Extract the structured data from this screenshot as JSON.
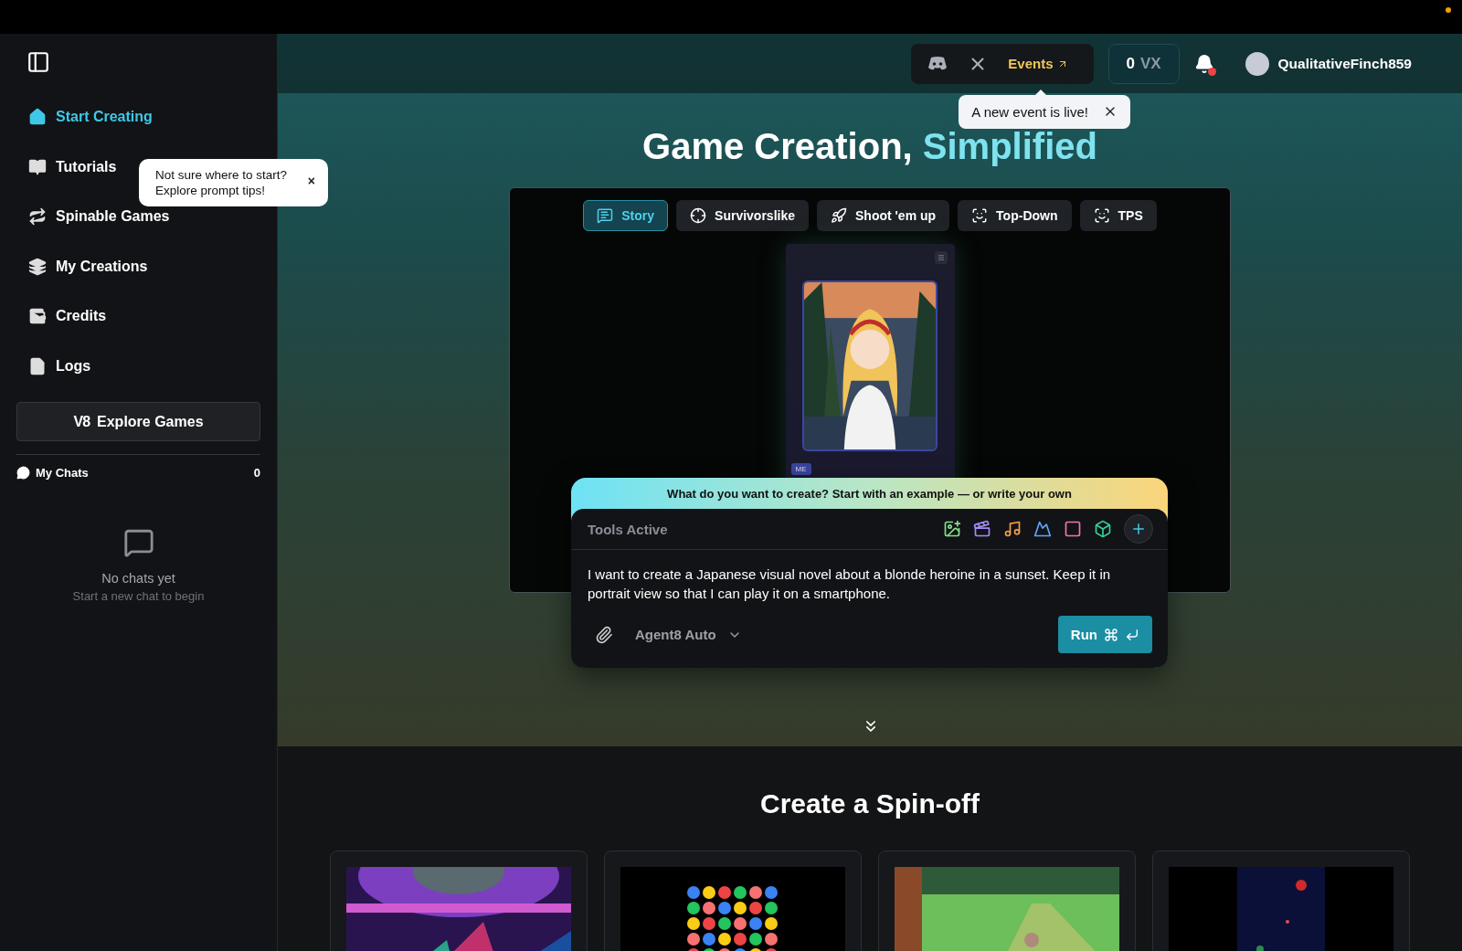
{
  "sidebar": {
    "items": [
      {
        "label": "Start Creating",
        "selected": true
      },
      {
        "label": "Tutorials",
        "selected": false
      },
      {
        "label": "Spinable Games",
        "selected": false
      },
      {
        "label": "My Creations",
        "selected": false
      },
      {
        "label": "Credits",
        "selected": false
      },
      {
        "label": "Logs",
        "selected": false
      }
    ],
    "tip": {
      "text": "Not sure where to start? Explore prompt tips!",
      "close": "×"
    },
    "explore": {
      "logo": "V8",
      "label": "Explore Games"
    },
    "chats": {
      "title": "My Chats",
      "count": "0",
      "empty_title": "No chats yet",
      "empty_hint": "Start a new chat to begin"
    }
  },
  "header": {
    "events": "Events",
    "balance": {
      "amount": "0",
      "unit": "VX"
    },
    "notification": true,
    "username": "QualitativeFinch859",
    "event_toast": "A new event is live!"
  },
  "hero": {
    "title_plain": "Game Creation,",
    "title_accent": "Simplified",
    "tabs": [
      {
        "label": "Story",
        "selected": true
      },
      {
        "label": "Survivorslike",
        "selected": false
      },
      {
        "label": "Shoot 'em up",
        "selected": false
      },
      {
        "label": "Top-Down",
        "selected": false
      },
      {
        "label": "TPS",
        "selected": false
      }
    ],
    "preview": {
      "badge": "ME"
    },
    "prompt": {
      "banner": "What do you want to create? Start with an example — or write your own",
      "tools_label": "Tools Active",
      "text": "I want to create a Japanese visual novel about a blonde heroine in a sunset. Keep it in portrait view so that I can play it on a smartphone.",
      "model": "Agent8 Auto",
      "run": "Run"
    }
  },
  "spinoff": {
    "title": "Create a Spin-off"
  }
}
